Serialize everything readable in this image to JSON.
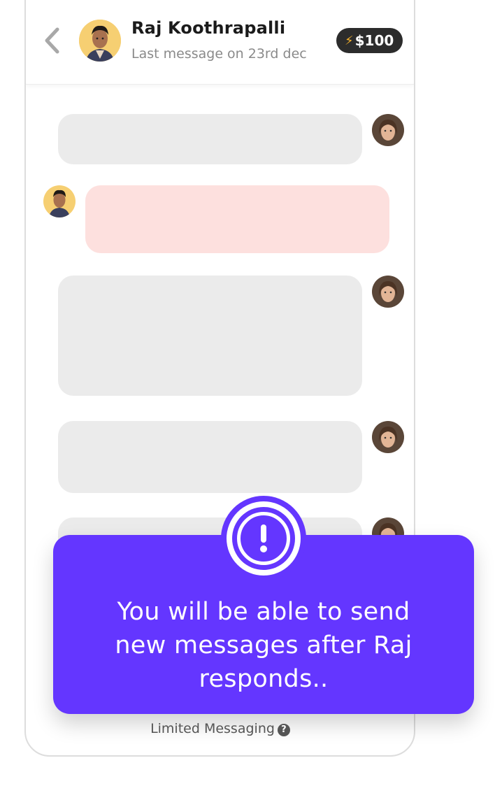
{
  "header": {
    "contact_name": "Raj Koothrapalli",
    "last_message": "Last message on 23rd dec",
    "balance": "$100",
    "balance_icon": "lightning-icon"
  },
  "messages": [
    {
      "sender": "self",
      "style": "placeholder"
    },
    {
      "sender": "contact",
      "style": "placeholder"
    },
    {
      "sender": "self",
      "style": "placeholder"
    },
    {
      "sender": "self",
      "style": "placeholder"
    },
    {
      "sender": "self",
      "style": "placeholder"
    }
  ],
  "toast": {
    "icon": "exclamation-icon",
    "message": "You will be able to send new messages after Raj responds.."
  },
  "footer": {
    "limited_label": "Limited Messaging",
    "help_icon": "question-circle-icon"
  },
  "colors": {
    "accent": "#6436FF",
    "bubble_self": "#EBEBEB",
    "bubble_contact": "#FDE0DE",
    "badge_bg": "#2C2C2C",
    "bolt": "#F5B12A"
  }
}
